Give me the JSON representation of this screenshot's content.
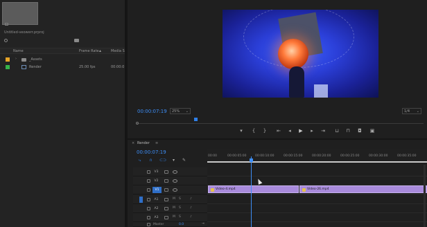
{
  "project": {
    "name": "Untitled-veowerr.prproj",
    "columns": {
      "name": "Name",
      "frame_rate": "Frame Rate",
      "media_start": "Media S"
    },
    "items": [
      {
        "color": "#e6a428",
        "type": "folder",
        "name": "_Assets",
        "frame_rate": "",
        "media_start": ""
      },
      {
        "color": "#36b34a",
        "type": "sequence",
        "name": "Render",
        "frame_rate": "25.00 fps",
        "media_start": "00:00:0"
      }
    ]
  },
  "monitor": {
    "timecode": "00:00:07:19",
    "zoom": "25%",
    "resolution": "1/4",
    "controls": [
      "marker-icon",
      "mark-in-icon",
      "mark-out-icon",
      "go-to-in-icon",
      "step-back-icon",
      "play-icon",
      "step-forward-icon",
      "go-to-out-icon",
      "lift-icon",
      "extract-icon",
      "export-frame-icon",
      "compare-icon"
    ]
  },
  "timeline": {
    "tab": "Render",
    "timecode": "00:00:07:19",
    "ruler_labels": [
      "00:00",
      "00:00:05:00",
      "00:00:10:00",
      "00:00:15:00",
      "00:00:20:00",
      "00:00:25:00",
      "00:00:30:00",
      "00:00:35:00"
    ],
    "video_tracks": [
      "V3",
      "V2",
      "V1"
    ],
    "audio_tracks": [
      "A1",
      "A2",
      "A3"
    ],
    "source_tag": "V1",
    "master": {
      "label": "Master",
      "value": "0.0"
    },
    "clips": [
      {
        "name": "Video-4.mp4",
        "color": "#a98bdc"
      },
      {
        "name": "Video-26.mp4",
        "color": "#a98bdc"
      }
    ]
  }
}
